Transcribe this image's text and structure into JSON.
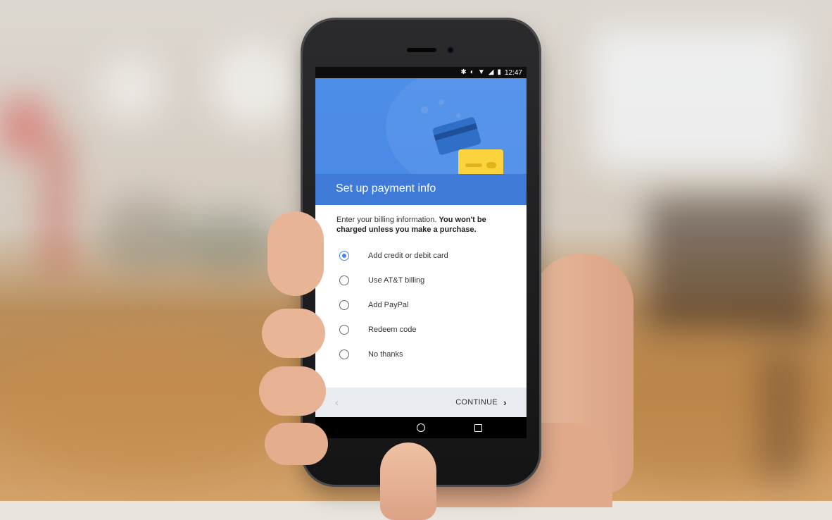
{
  "status_bar": {
    "time": "12:47",
    "icons": [
      "bluetooth-icon",
      "vibrate-icon",
      "wifi-icon",
      "signal-icon",
      "battery-icon"
    ]
  },
  "header": {
    "title": "Set up payment info",
    "illustration": "credit-cards-illustration"
  },
  "content": {
    "intro_text": "Enter your billing information.",
    "intro_bold": "You won't be charged unless you make a purchase."
  },
  "options": [
    {
      "label": "Add credit or debit card",
      "selected": true
    },
    {
      "label": "Use AT&T billing",
      "selected": false
    },
    {
      "label": "Add PayPal",
      "selected": false
    },
    {
      "label": "Redeem code",
      "selected": false
    },
    {
      "label": "No thanks",
      "selected": false
    }
  ],
  "footer": {
    "back_glyph": "‹",
    "continue_label": "CONTINUE",
    "continue_glyph": "›"
  },
  "colors": {
    "primary_blue": "#4a88e4",
    "title_band": "#3f7ad9",
    "card_yellow": "#fbd33f",
    "card_blue": "#2f6fc8"
  }
}
